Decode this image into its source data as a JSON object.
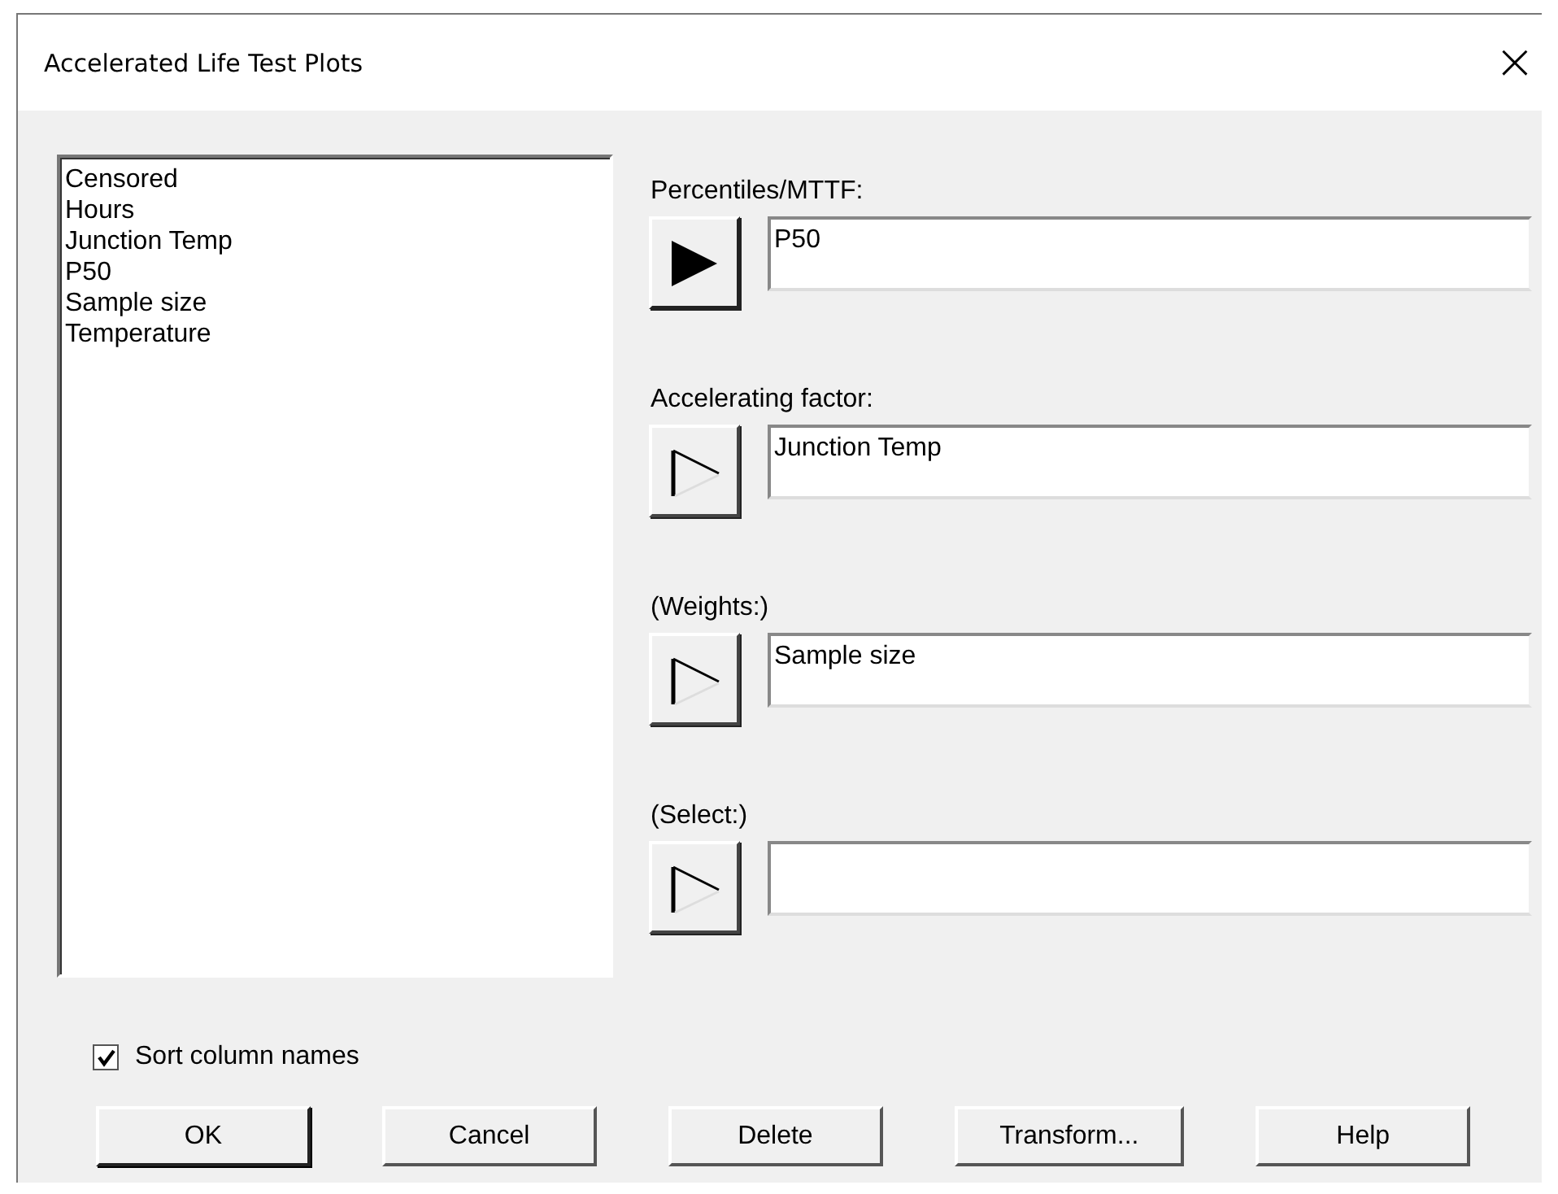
{
  "window": {
    "title": "Accelerated Life Test Plots",
    "close": "×"
  },
  "columns_list": [
    "Censored",
    "Hours",
    "Junction Temp",
    "P50",
    "Sample size",
    "Temperature"
  ],
  "fields": [
    {
      "label": "Percentiles/MTTF:",
      "value": "P50",
      "active": true
    },
    {
      "label": "Accelerating factor:",
      "value": "Junction Temp",
      "active": false
    },
    {
      "label": "(Weights:)",
      "value": "Sample size",
      "active": false
    },
    {
      "label": "(Select:)",
      "active": false
    }
  ],
  "sort_option": {
    "label": "Sort column names",
    "checked": true
  },
  "buttons": [
    "OK",
    "Cancel",
    "Delete",
    "Transform...",
    "Help"
  ]
}
